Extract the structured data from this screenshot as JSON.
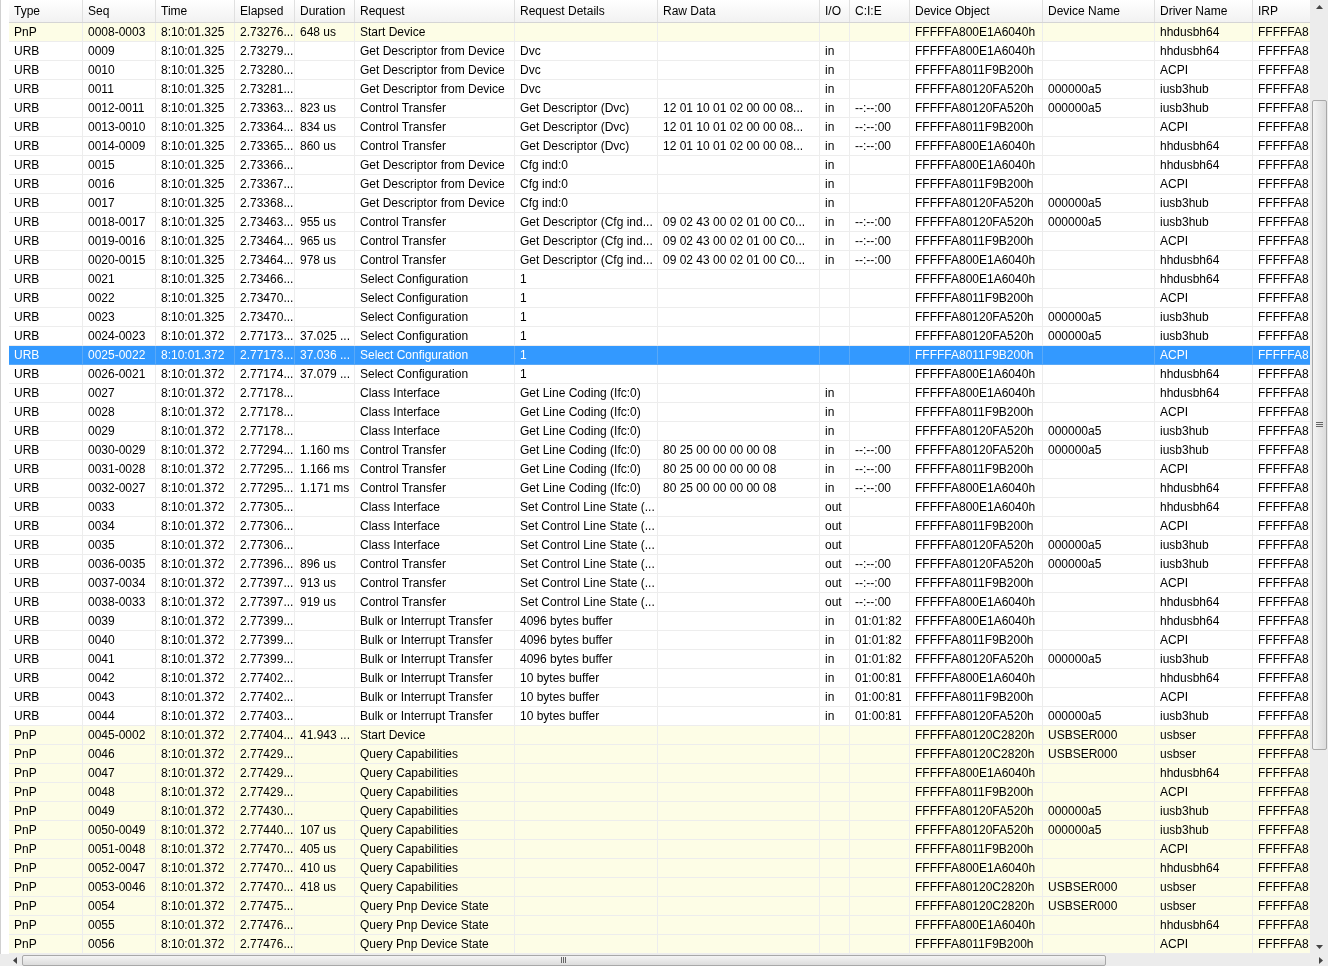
{
  "table": {
    "columns": [
      "Type",
      "Seq",
      "Time",
      "Elapsed",
      "Duration",
      "Request",
      "Request Details",
      "Raw Data",
      "I/O",
      "C:I:E",
      "Device Object",
      "Device Name",
      "Driver Name",
      "IRP"
    ],
    "rows": [
      {
        "kind": "pnp",
        "selected": false,
        "cells": [
          "PnP",
          "0008-0003",
          "8:10:01.325",
          "2.73276...",
          "648 us",
          "Start Device",
          null,
          null,
          null,
          null,
          "FFFFFA800E1A6040h",
          null,
          "hhdusbh64",
          "FFFFFA8"
        ]
      },
      {
        "kind": "urb",
        "selected": false,
        "cells": [
          "URB",
          "0009",
          "8:10:01.325",
          "2.73279...",
          null,
          "Get Descriptor from Device",
          "Dvc",
          null,
          "in",
          null,
          "FFFFFA800E1A6040h",
          null,
          "hhdusbh64",
          "FFFFFA8"
        ]
      },
      {
        "kind": "urb",
        "selected": false,
        "cells": [
          "URB",
          "0010",
          "8:10:01.325",
          "2.73280...",
          null,
          "Get Descriptor from Device",
          "Dvc",
          null,
          "in",
          null,
          "FFFFFA8011F9B200h",
          null,
          "ACPI",
          "FFFFFA8"
        ]
      },
      {
        "kind": "urb",
        "selected": false,
        "cells": [
          "URB",
          "0011",
          "8:10:01.325",
          "2.73281...",
          null,
          "Get Descriptor from Device",
          "Dvc",
          null,
          "in",
          null,
          "FFFFFA80120FA520h",
          "000000a5",
          "iusb3hub",
          "FFFFFA8"
        ]
      },
      {
        "kind": "urb",
        "selected": false,
        "cells": [
          "URB",
          "0012-0011",
          "8:10:01.325",
          "2.73363...",
          "823 us",
          "Control Transfer",
          "Get Descriptor (Dvc)",
          "12 01 10 01 02 00 00 08...",
          "in",
          "--:--:00",
          "FFFFFA80120FA520h",
          "000000a5",
          "iusb3hub",
          "FFFFFA8"
        ]
      },
      {
        "kind": "urb",
        "selected": false,
        "cells": [
          "URB",
          "0013-0010",
          "8:10:01.325",
          "2.73364...",
          "834 us",
          "Control Transfer",
          "Get Descriptor (Dvc)",
          "12 01 10 01 02 00 00 08...",
          "in",
          "--:--:00",
          "FFFFFA8011F9B200h",
          null,
          "ACPI",
          "FFFFFA8"
        ]
      },
      {
        "kind": "urb",
        "selected": false,
        "cells": [
          "URB",
          "0014-0009",
          "8:10:01.325",
          "2.73365...",
          "860 us",
          "Control Transfer",
          "Get Descriptor (Dvc)",
          "12 01 10 01 02 00 00 08...",
          "in",
          "--:--:00",
          "FFFFFA800E1A6040h",
          null,
          "hhdusbh64",
          "FFFFFA8"
        ]
      },
      {
        "kind": "urb",
        "selected": false,
        "cells": [
          "URB",
          "0015",
          "8:10:01.325",
          "2.73366...",
          null,
          "Get Descriptor from Device",
          "Cfg ind:0",
          null,
          "in",
          null,
          "FFFFFA800E1A6040h",
          null,
          "hhdusbh64",
          "FFFFFA8"
        ]
      },
      {
        "kind": "urb",
        "selected": false,
        "cells": [
          "URB",
          "0016",
          "8:10:01.325",
          "2.73367...",
          null,
          "Get Descriptor from Device",
          "Cfg ind:0",
          null,
          "in",
          null,
          "FFFFFA8011F9B200h",
          null,
          "ACPI",
          "FFFFFA8"
        ]
      },
      {
        "kind": "urb",
        "selected": false,
        "cells": [
          "URB",
          "0017",
          "8:10:01.325",
          "2.73368...",
          null,
          "Get Descriptor from Device",
          "Cfg ind:0",
          null,
          "in",
          null,
          "FFFFFA80120FA520h",
          "000000a5",
          "iusb3hub",
          "FFFFFA8"
        ]
      },
      {
        "kind": "urb",
        "selected": false,
        "cells": [
          "URB",
          "0018-0017",
          "8:10:01.325",
          "2.73463...",
          "955 us",
          "Control Transfer",
          "Get Descriptor (Cfg ind...",
          "09 02 43 00 02 01 00 C0...",
          "in",
          "--:--:00",
          "FFFFFA80120FA520h",
          "000000a5",
          "iusb3hub",
          "FFFFFA8"
        ]
      },
      {
        "kind": "urb",
        "selected": false,
        "cells": [
          "URB",
          "0019-0016",
          "8:10:01.325",
          "2.73464...",
          "965 us",
          "Control Transfer",
          "Get Descriptor (Cfg ind...",
          "09 02 43 00 02 01 00 C0...",
          "in",
          "--:--:00",
          "FFFFFA8011F9B200h",
          null,
          "ACPI",
          "FFFFFA8"
        ]
      },
      {
        "kind": "urb",
        "selected": false,
        "cells": [
          "URB",
          "0020-0015",
          "8:10:01.325",
          "2.73464...",
          "978 us",
          "Control Transfer",
          "Get Descriptor (Cfg ind...",
          "09 02 43 00 02 01 00 C0...",
          "in",
          "--:--:00",
          "FFFFFA800E1A6040h",
          null,
          "hhdusbh64",
          "FFFFFA8"
        ]
      },
      {
        "kind": "urb",
        "selected": false,
        "cells": [
          "URB",
          "0021",
          "8:10:01.325",
          "2.73466...",
          null,
          "Select Configuration",
          "1",
          null,
          null,
          null,
          "FFFFFA800E1A6040h",
          null,
          "hhdusbh64",
          "FFFFFA8"
        ]
      },
      {
        "kind": "urb",
        "selected": false,
        "cells": [
          "URB",
          "0022",
          "8:10:01.325",
          "2.73470...",
          null,
          "Select Configuration",
          "1",
          null,
          null,
          null,
          "FFFFFA8011F9B200h",
          null,
          "ACPI",
          "FFFFFA8"
        ]
      },
      {
        "kind": "urb",
        "selected": false,
        "cells": [
          "URB",
          "0023",
          "8:10:01.325",
          "2.73470...",
          null,
          "Select Configuration",
          "1",
          null,
          null,
          null,
          "FFFFFA80120FA520h",
          "000000a5",
          "iusb3hub",
          "FFFFFA8"
        ]
      },
      {
        "kind": "urb",
        "selected": false,
        "cells": [
          "URB",
          "0024-0023",
          "8:10:01.372",
          "2.77173...",
          "37.025 ...",
          "Select Configuration",
          "1",
          null,
          null,
          null,
          "FFFFFA80120FA520h",
          "000000a5",
          "iusb3hub",
          "FFFFFA8"
        ]
      },
      {
        "selected": true,
        "cells": [
          "URB",
          "0025-0022",
          "8:10:01.372",
          "2.77173...",
          "37.036 ...",
          "Select Configuration",
          "1",
          null,
          null,
          null,
          "FFFFFA8011F9B200h",
          null,
          "ACPI",
          "FFFFFA8"
        ]
      },
      {
        "kind": "urb",
        "selected": false,
        "cells": [
          "URB",
          "0026-0021",
          "8:10:01.372",
          "2.77174...",
          "37.079 ...",
          "Select Configuration",
          "1",
          null,
          null,
          null,
          "FFFFFA800E1A6040h",
          null,
          "hhdusbh64",
          "FFFFFA8"
        ]
      },
      {
        "kind": "urb",
        "selected": false,
        "cells": [
          "URB",
          "0027",
          "8:10:01.372",
          "2.77178...",
          null,
          "Class Interface",
          "Get Line Coding (Ifc:0)",
          null,
          "in",
          null,
          "FFFFFA800E1A6040h",
          null,
          "hhdusbh64",
          "FFFFFA8"
        ]
      },
      {
        "kind": "urb",
        "selected": false,
        "cells": [
          "URB",
          "0028",
          "8:10:01.372",
          "2.77178...",
          null,
          "Class Interface",
          "Get Line Coding (Ifc:0)",
          null,
          "in",
          null,
          "FFFFFA8011F9B200h",
          null,
          "ACPI",
          "FFFFFA8"
        ]
      },
      {
        "kind": "urb",
        "selected": false,
        "cells": [
          "URB",
          "0029",
          "8:10:01.372",
          "2.77178...",
          null,
          "Class Interface",
          "Get Line Coding (Ifc:0)",
          null,
          "in",
          null,
          "FFFFFA80120FA520h",
          "000000a5",
          "iusb3hub",
          "FFFFFA8"
        ]
      },
      {
        "kind": "urb",
        "selected": false,
        "cells": [
          "URB",
          "0030-0029",
          "8:10:01.372",
          "2.77294...",
          "1.160 ms",
          "Control Transfer",
          "Get Line Coding (Ifc:0)",
          "80 25 00 00 00 00 08",
          "in",
          "--:--:00",
          "FFFFFA80120FA520h",
          "000000a5",
          "iusb3hub",
          "FFFFFA8"
        ]
      },
      {
        "kind": "urb",
        "selected": false,
        "cells": [
          "URB",
          "0031-0028",
          "8:10:01.372",
          "2.77295...",
          "1.166 ms",
          "Control Transfer",
          "Get Line Coding (Ifc:0)",
          "80 25 00 00 00 00 08",
          "in",
          "--:--:00",
          "FFFFFA8011F9B200h",
          null,
          "ACPI",
          "FFFFFA8"
        ]
      },
      {
        "kind": "urb",
        "selected": false,
        "cells": [
          "URB",
          "0032-0027",
          "8:10:01.372",
          "2.77295...",
          "1.171 ms",
          "Control Transfer",
          "Get Line Coding (Ifc:0)",
          "80 25 00 00 00 00 08",
          "in",
          "--:--:00",
          "FFFFFA800E1A6040h",
          null,
          "hhdusbh64",
          "FFFFFA8"
        ]
      },
      {
        "kind": "urb",
        "selected": false,
        "cells": [
          "URB",
          "0033",
          "8:10:01.372",
          "2.77305...",
          null,
          "Class Interface",
          "Set Control Line State (...",
          null,
          "out",
          null,
          "FFFFFA800E1A6040h",
          null,
          "hhdusbh64",
          "FFFFFA8"
        ]
      },
      {
        "kind": "urb",
        "selected": false,
        "cells": [
          "URB",
          "0034",
          "8:10:01.372",
          "2.77306...",
          null,
          "Class Interface",
          "Set Control Line State (...",
          null,
          "out",
          null,
          "FFFFFA8011F9B200h",
          null,
          "ACPI",
          "FFFFFA8"
        ]
      },
      {
        "kind": "urb",
        "selected": false,
        "cells": [
          "URB",
          "0035",
          "8:10:01.372",
          "2.77306...",
          null,
          "Class Interface",
          "Set Control Line State (...",
          null,
          "out",
          null,
          "FFFFFA80120FA520h",
          "000000a5",
          "iusb3hub",
          "FFFFFA8"
        ]
      },
      {
        "kind": "urb",
        "selected": false,
        "cells": [
          "URB",
          "0036-0035",
          "8:10:01.372",
          "2.77396...",
          "896 us",
          "Control Transfer",
          "Set Control Line State (...",
          null,
          "out",
          "--:--:00",
          "FFFFFA80120FA520h",
          "000000a5",
          "iusb3hub",
          "FFFFFA8"
        ]
      },
      {
        "kind": "urb",
        "selected": false,
        "cells": [
          "URB",
          "0037-0034",
          "8:10:01.372",
          "2.77397...",
          "913 us",
          "Control Transfer",
          "Set Control Line State (...",
          null,
          "out",
          "--:--:00",
          "FFFFFA8011F9B200h",
          null,
          "ACPI",
          "FFFFFA8"
        ]
      },
      {
        "kind": "urb",
        "selected": false,
        "cells": [
          "URB",
          "0038-0033",
          "8:10:01.372",
          "2.77397...",
          "919 us",
          "Control Transfer",
          "Set Control Line State (...",
          null,
          "out",
          "--:--:00",
          "FFFFFA800E1A6040h",
          null,
          "hhdusbh64",
          "FFFFFA8"
        ]
      },
      {
        "kind": "urb",
        "selected": false,
        "cells": [
          "URB",
          "0039",
          "8:10:01.372",
          "2.77399...",
          null,
          "Bulk or Interrupt Transfer",
          "4096 bytes buffer",
          null,
          "in",
          "01:01:82",
          "FFFFFA800E1A6040h",
          null,
          "hhdusbh64",
          "FFFFFA8"
        ]
      },
      {
        "kind": "urb",
        "selected": false,
        "cells": [
          "URB",
          "0040",
          "8:10:01.372",
          "2.77399...",
          null,
          "Bulk or Interrupt Transfer",
          "4096 bytes buffer",
          null,
          "in",
          "01:01:82",
          "FFFFFA8011F9B200h",
          null,
          "ACPI",
          "FFFFFA8"
        ]
      },
      {
        "kind": "urb",
        "selected": false,
        "cells": [
          "URB",
          "0041",
          "8:10:01.372",
          "2.77399...",
          null,
          "Bulk or Interrupt Transfer",
          "4096 bytes buffer",
          null,
          "in",
          "01:01:82",
          "FFFFFA80120FA520h",
          "000000a5",
          "iusb3hub",
          "FFFFFA8"
        ]
      },
      {
        "kind": "urb",
        "selected": false,
        "cells": [
          "URB",
          "0042",
          "8:10:01.372",
          "2.77402...",
          null,
          "Bulk or Interrupt Transfer",
          "10 bytes buffer",
          null,
          "in",
          "01:00:81",
          "FFFFFA800E1A6040h",
          null,
          "hhdusbh64",
          "FFFFFA8"
        ]
      },
      {
        "kind": "urb",
        "selected": false,
        "cells": [
          "URB",
          "0043",
          "8:10:01.372",
          "2.77402...",
          null,
          "Bulk or Interrupt Transfer",
          "10 bytes buffer",
          null,
          "in",
          "01:00:81",
          "FFFFFA8011F9B200h",
          null,
          "ACPI",
          "FFFFFA8"
        ]
      },
      {
        "kind": "urb",
        "selected": false,
        "cells": [
          "URB",
          "0044",
          "8:10:01.372",
          "2.77403...",
          null,
          "Bulk or Interrupt Transfer",
          "10 bytes buffer",
          null,
          "in",
          "01:00:81",
          "FFFFFA80120FA520h",
          "000000a5",
          "iusb3hub",
          "FFFFFA8"
        ]
      },
      {
        "kind": "pnp",
        "selected": false,
        "cells": [
          "PnP",
          "0045-0002",
          "8:10:01.372",
          "2.77404...",
          "41.943 ...",
          "Start Device",
          null,
          null,
          null,
          null,
          "FFFFFA80120C2820h",
          "USBSER000",
          "usbser",
          "FFFFFA8"
        ]
      },
      {
        "kind": "pnp",
        "selected": false,
        "cells": [
          "PnP",
          "0046",
          "8:10:01.372",
          "2.77429...",
          null,
          "Query Capabilities",
          null,
          null,
          null,
          null,
          "FFFFFA80120C2820h",
          "USBSER000",
          "usbser",
          "FFFFFA8"
        ]
      },
      {
        "kind": "pnp",
        "selected": false,
        "cells": [
          "PnP",
          "0047",
          "8:10:01.372",
          "2.77429...",
          null,
          "Query Capabilities",
          null,
          null,
          null,
          null,
          "FFFFFA800E1A6040h",
          null,
          "hhdusbh64",
          "FFFFFA8"
        ]
      },
      {
        "kind": "pnp",
        "selected": false,
        "cells": [
          "PnP",
          "0048",
          "8:10:01.372",
          "2.77429...",
          null,
          "Query Capabilities",
          null,
          null,
          null,
          null,
          "FFFFFA8011F9B200h",
          null,
          "ACPI",
          "FFFFFA8"
        ]
      },
      {
        "kind": "pnp",
        "selected": false,
        "cells": [
          "PnP",
          "0049",
          "8:10:01.372",
          "2.77430...",
          null,
          "Query Capabilities",
          null,
          null,
          null,
          null,
          "FFFFFA80120FA520h",
          "000000a5",
          "iusb3hub",
          "FFFFFA8"
        ]
      },
      {
        "kind": "pnp",
        "selected": false,
        "cells": [
          "PnP",
          "0050-0049",
          "8:10:01.372",
          "2.77440...",
          "107 us",
          "Query Capabilities",
          null,
          null,
          null,
          null,
          "FFFFFA80120FA520h",
          "000000a5",
          "iusb3hub",
          "FFFFFA8"
        ]
      },
      {
        "kind": "pnp",
        "selected": false,
        "cells": [
          "PnP",
          "0051-0048",
          "8:10:01.372",
          "2.77470...",
          "405 us",
          "Query Capabilities",
          null,
          null,
          null,
          null,
          "FFFFFA8011F9B200h",
          null,
          "ACPI",
          "FFFFFA8"
        ]
      },
      {
        "kind": "pnp",
        "selected": false,
        "cells": [
          "PnP",
          "0052-0047",
          "8:10:01.372",
          "2.77470...",
          "410 us",
          "Query Capabilities",
          null,
          null,
          null,
          null,
          "FFFFFA800E1A6040h",
          null,
          "hhdusbh64",
          "FFFFFA8"
        ]
      },
      {
        "kind": "pnp",
        "selected": false,
        "cells": [
          "PnP",
          "0053-0046",
          "8:10:01.372",
          "2.77470...",
          "418 us",
          "Query Capabilities",
          null,
          null,
          null,
          null,
          "FFFFFA80120C2820h",
          "USBSER000",
          "usbser",
          "FFFFFA8"
        ]
      },
      {
        "kind": "pnp",
        "selected": false,
        "cells": [
          "PnP",
          "0054",
          "8:10:01.372",
          "2.77475...",
          null,
          "Query Pnp Device State",
          null,
          null,
          null,
          null,
          "FFFFFA80120C2820h",
          "USBSER000",
          "usbser",
          "FFFFFA8"
        ]
      },
      {
        "kind": "pnp",
        "selected": false,
        "cells": [
          "PnP",
          "0055",
          "8:10:01.372",
          "2.77476...",
          null,
          "Query Pnp Device State",
          null,
          null,
          null,
          null,
          "FFFFFA800E1A6040h",
          null,
          "hhdusbh64",
          "FFFFFA8"
        ]
      },
      {
        "kind": "pnp",
        "selected": false,
        "cells": [
          "PnP",
          "0056",
          "8:10:01.372",
          "2.77476...",
          null,
          "Query Pnp Device State",
          null,
          null,
          null,
          null,
          "FFFFFA8011F9B200h",
          null,
          "ACPI",
          "FFFFFA8"
        ]
      }
    ]
  }
}
